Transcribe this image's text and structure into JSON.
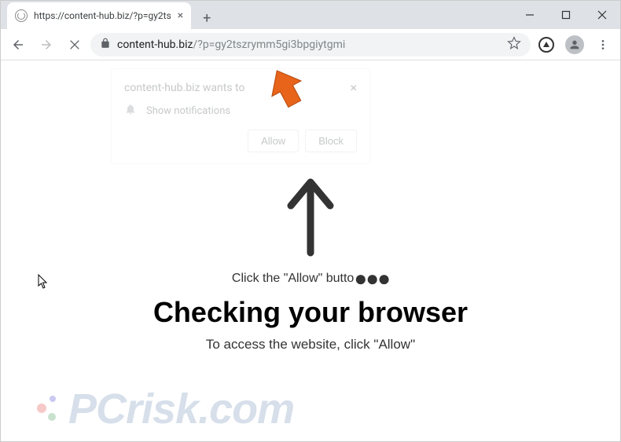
{
  "window": {
    "minimize_label": "Minimize",
    "maximize_label": "Maximize",
    "close_label": "Close"
  },
  "tab": {
    "title": "https://content-hub.biz/?p=gy2ts",
    "close_label": "×"
  },
  "newtab": {
    "label": "+"
  },
  "toolbar": {
    "back_label": "Back",
    "forward_label": "Forward",
    "stop_label": "Stop"
  },
  "omnibox": {
    "lock_name": "lock-icon",
    "domain": "content-hub.biz",
    "path": "/?p=gy2tszrymm5gi3bpgiytgmi",
    "star_label": "Bookmark"
  },
  "notif": {
    "title": "content-hub.biz wants to",
    "close": "×",
    "body": "Show notifications",
    "allow": "Allow",
    "block": "Block"
  },
  "page": {
    "click_text": "Click the \"Allow\" butto",
    "heading": "Checking your browser",
    "subtext": "To access the website, click \"Allow\""
  },
  "watermark": {
    "text": "PCrisk.com"
  }
}
